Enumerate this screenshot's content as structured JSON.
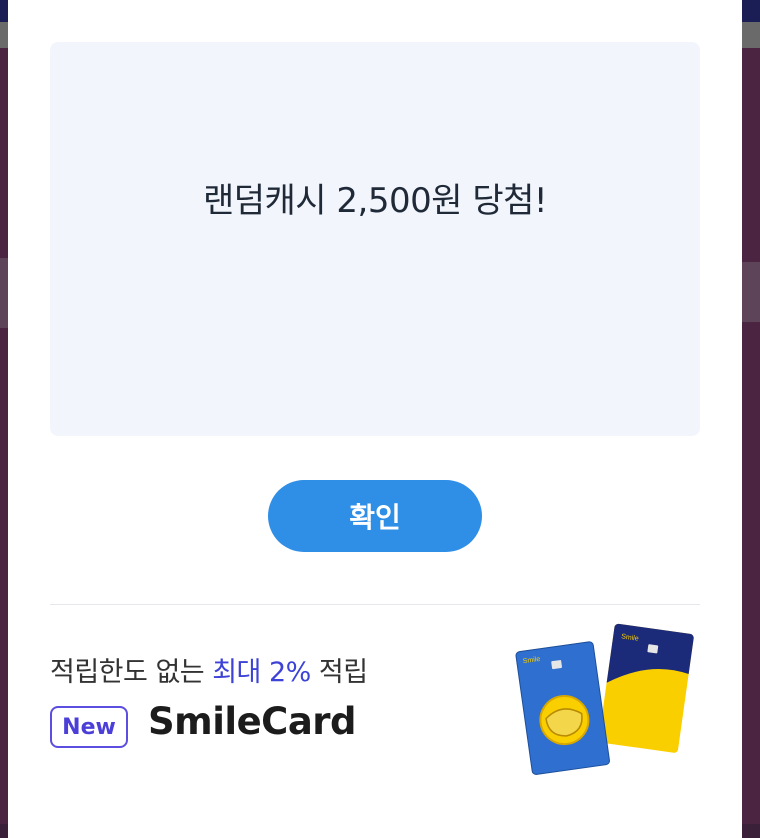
{
  "modal": {
    "message": "랜덤캐시 2,500원 당첨!",
    "confirm_label": "확인"
  },
  "promo": {
    "text_before": "적립한도 없는 ",
    "text_highlight": "최대 2%",
    "text_after": " 적립",
    "badge": "New",
    "card_name": "SmileCard",
    "card_brand_text": "Smile"
  },
  "colors": {
    "button": "#2f8ee5",
    "highlight": "#3d43d6",
    "badge": "#5b4ee0",
    "message_bg": "#f2f6fc"
  }
}
